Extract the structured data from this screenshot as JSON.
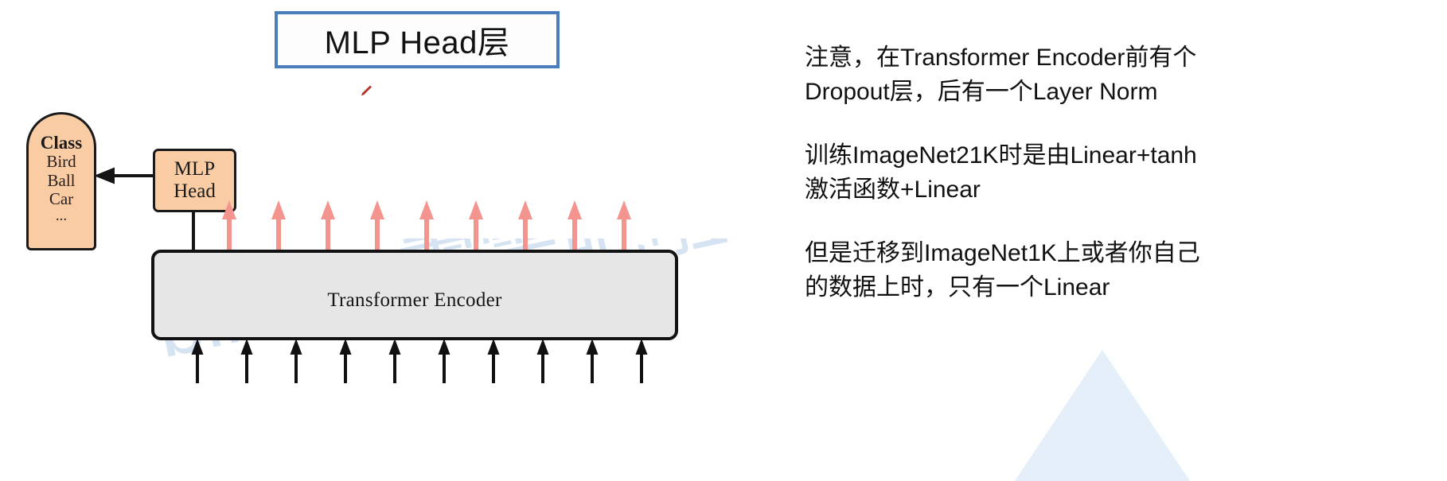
{
  "title_box": {
    "text": "MLP Head层",
    "border_color": "#4A7EBB",
    "fill_color": "#FDFDFD"
  },
  "diagram": {
    "class_box": {
      "heading": "Class",
      "items": [
        "Bird",
        "Ball",
        "Car"
      ],
      "ellipsis": "...",
      "fill_color": "#F9CCA4",
      "stroke_color": "#1A1A1A"
    },
    "mlp_head_box": {
      "line1": "MLP",
      "line2": "Head",
      "fill_color": "#F9CCA4",
      "stroke_color": "#1A1A1A"
    },
    "encoder_box": {
      "label": "Transformer Encoder",
      "fill_color": "#E6E6E6",
      "stroke_color": "#121212"
    },
    "arrows": {
      "top_count": 9,
      "top_color": "#F4948E",
      "bottom_count": 10,
      "bottom_color": "#111111",
      "class_arrow_color": "#151515"
    }
  },
  "watermark": {
    "text": "bilibili: 霹雾吧啦Wz",
    "color": "#D3E2F2"
  },
  "notes": {
    "paragraphs": [
      "注意，在Transformer Encoder前有个Dropout层，后有一个Layer Norm",
      "训练ImageNet21K时是由Linear+tanh激活函数+Linear",
      "但是迁移到ImageNet1K上或者你自己的数据上时，只有一个Linear"
    ]
  }
}
